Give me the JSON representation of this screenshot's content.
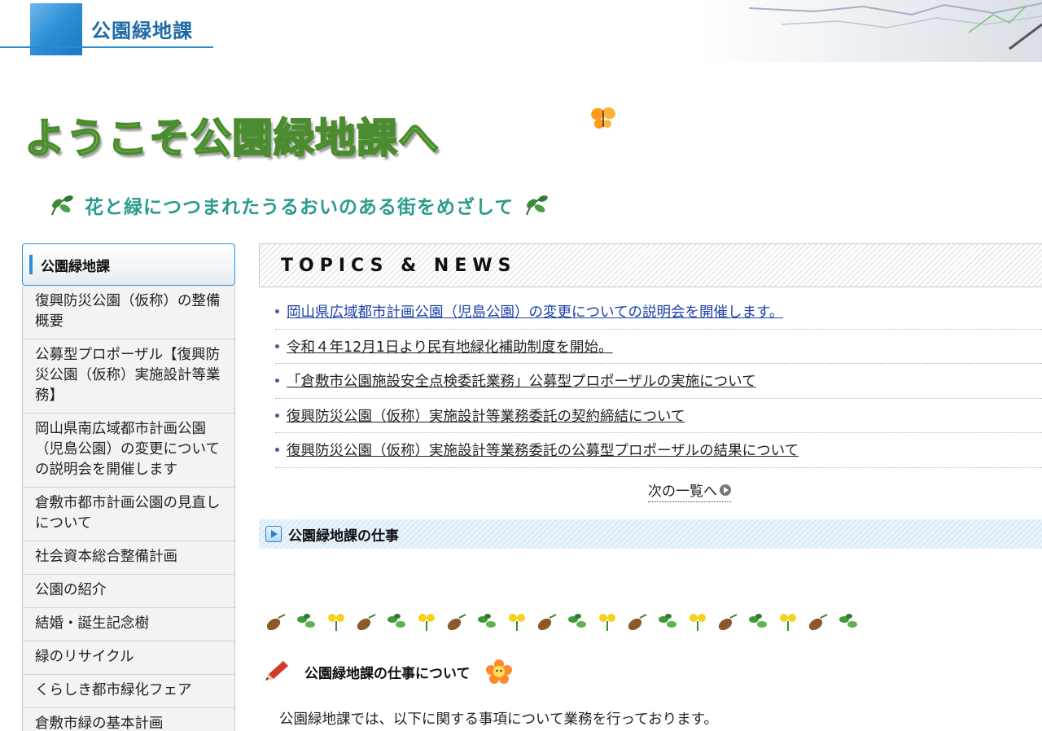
{
  "header": {
    "site_title": "公園緑地課"
  },
  "banner": {
    "welcome": "ようこそ公園緑地課へ",
    "subtitle": "花と緑につつまれたうるおいのある街をめざして"
  },
  "sidebar": {
    "heading": "公園緑地課",
    "items": [
      {
        "label": "復興防災公園（仮称）の整備概要"
      },
      {
        "label": "公募型プロポーザル【復興防災公園（仮称）実施設計等業務】"
      },
      {
        "label": "岡山県南広域都市計画公園（児島公園）の変更についての説明会を開催します"
      },
      {
        "label": "倉敷市都市計画公園の見直しについて"
      },
      {
        "label": "社会資本総合整備計画"
      },
      {
        "label": "公園の紹介"
      },
      {
        "label": "結婚・誕生記念樹"
      },
      {
        "label": "緑のリサイクル"
      },
      {
        "label": "くらしき都市緑化フェア"
      },
      {
        "label": "倉敷市緑の基本計画"
      }
    ]
  },
  "topics": {
    "heading": "TOPICS & NEWS",
    "items": [
      {
        "label": "岡山県広域都市計画公園（児島公園）の変更についての説明会を開催します。"
      },
      {
        "label": "令和４年12月1日より民有地緑化補助制度を開始。"
      },
      {
        "label": "「倉敷市公園施設安全点検委託業務」公募型プロポーザルの実施について"
      },
      {
        "label": "復興防災公園（仮称）実施設計等業務委託の契約締結について"
      },
      {
        "label": "復興防災公園（仮称）実施設計等業務委託の公募型プロポーザルの結果について"
      }
    ],
    "more_link": "次の一覧へ"
  },
  "work": {
    "heading": "公園緑地課の仕事",
    "about_title": "公園緑地課の仕事について",
    "intro": "公園緑地課では、以下に関する事項について業務を行っております。"
  },
  "colors": {
    "accent_blue": "#2f8ed8",
    "link_blue": "#1a3fa8",
    "subtitle_teal": "#2a9c8a",
    "welcome_green": "#8ad468"
  },
  "icons": {
    "butterfly": "butterfly-icon",
    "leaf": "leaf-icon",
    "pencil": "pencil-icon",
    "flower": "flower-icon",
    "play": "play-icon",
    "arrow": "arrow-circle-icon"
  }
}
